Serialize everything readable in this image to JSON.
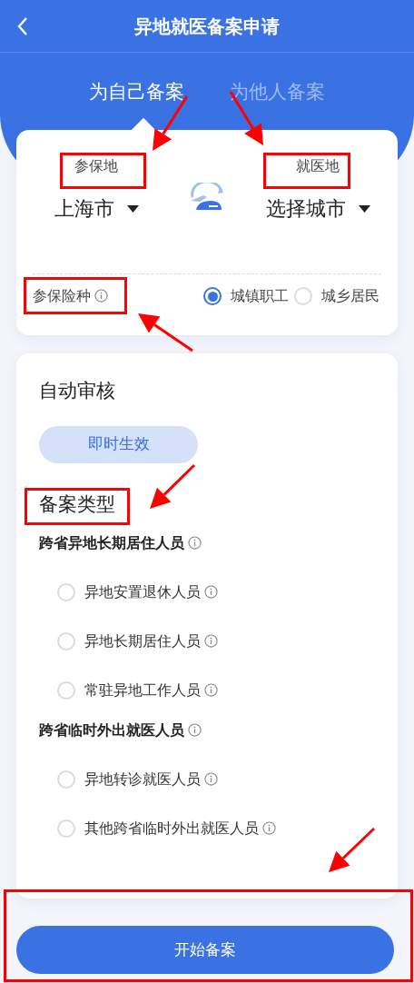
{
  "header": {
    "title": "异地就医备案申请"
  },
  "tabs": [
    {
      "label": "为自己备案",
      "selected": true
    },
    {
      "label": "为他人备案",
      "selected": false
    }
  ],
  "origin": {
    "label": "参保地",
    "city": "上海市"
  },
  "destination": {
    "label": "就医地",
    "city": "选择城市"
  },
  "insurance": {
    "label": "参保险种",
    "options": [
      {
        "label": "城镇职工",
        "selected": true
      },
      {
        "label": "城乡居民",
        "selected": false
      }
    ]
  },
  "review": {
    "title": "自动审核",
    "badge": "即时生效"
  },
  "filing_type": {
    "title": "备案类型",
    "groups": [
      {
        "title": "跨省异地长期居住人员",
        "options": [
          {
            "label": "异地安置退休人员",
            "selected": false
          },
          {
            "label": "异地长期居住人员",
            "selected": false
          },
          {
            "label": "常驻异地工作人员",
            "selected": false
          }
        ]
      },
      {
        "title": "跨省临时外出就医人员",
        "options": [
          {
            "label": "异地转诊就医人员",
            "selected": false
          },
          {
            "label": "其他跨省临时外出就医人员",
            "selected": false
          }
        ]
      }
    ]
  },
  "submit_button": "开始备案"
}
